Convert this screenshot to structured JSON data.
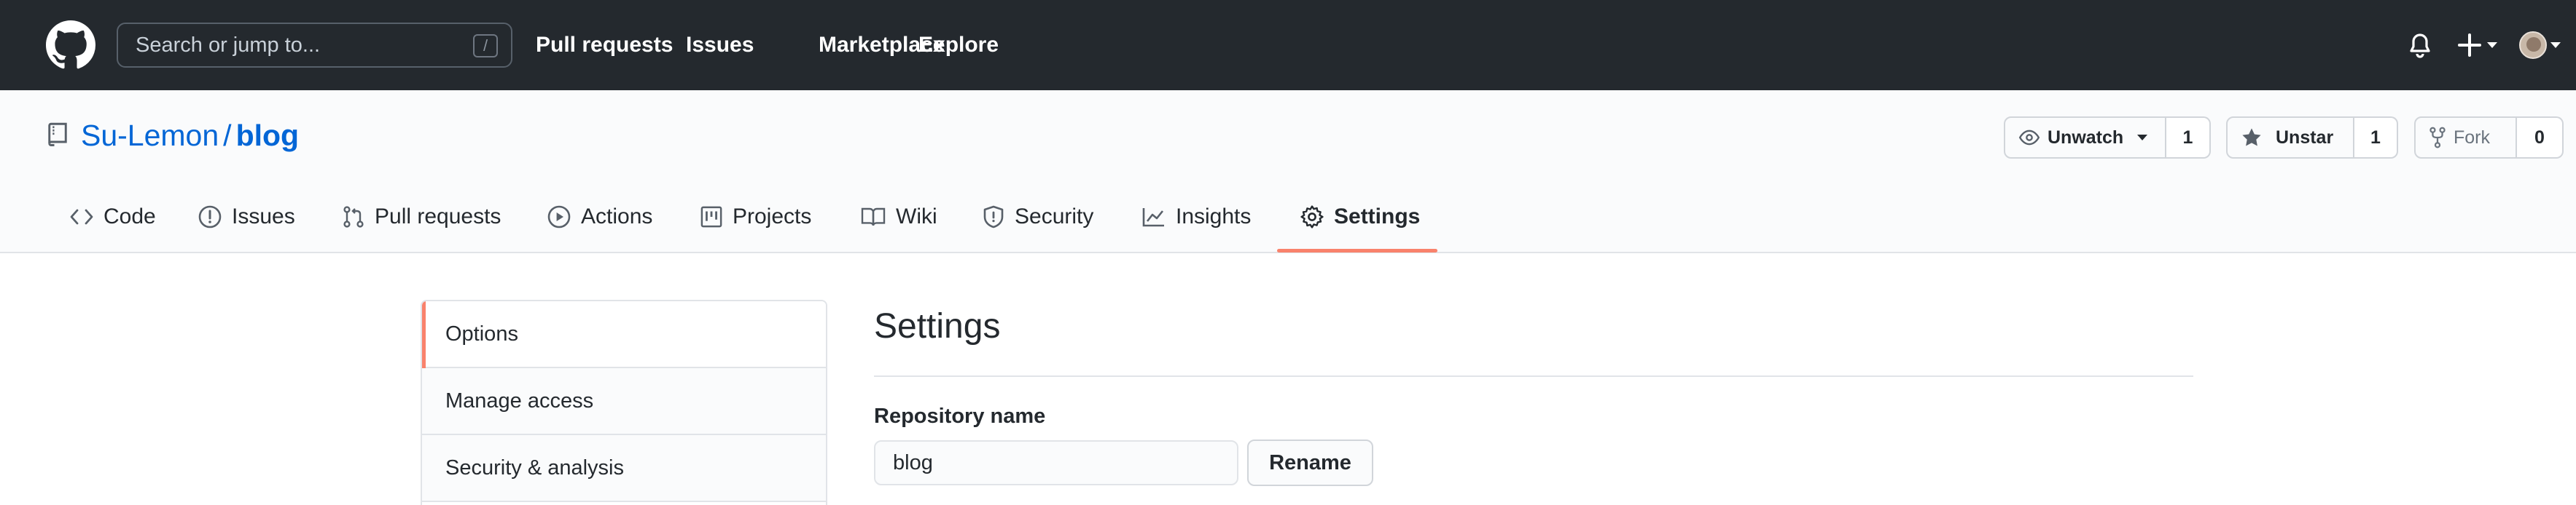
{
  "header": {
    "search_placeholder": "Search or jump to...",
    "search_shortcut": "/",
    "nav": [
      "Pull requests",
      "Issues",
      "Marketplace",
      "Explore"
    ]
  },
  "repo": {
    "owner": "Su-Lemon",
    "separator": "/",
    "name": "blog",
    "watch": {
      "label": "Unwatch",
      "count": "1"
    },
    "star": {
      "label": "Unstar",
      "count": "1"
    },
    "fork": {
      "label": "Fork",
      "count": "0"
    }
  },
  "tabs": [
    "Code",
    "Issues",
    "Pull requests",
    "Actions",
    "Projects",
    "Wiki",
    "Security",
    "Insights",
    "Settings"
  ],
  "selected_tab": "Settings",
  "menu": [
    "Options",
    "Manage access",
    "Security & analysis"
  ],
  "settings": {
    "title": "Settings",
    "repo_name_label": "Repository name",
    "repo_name_value": "blog",
    "rename_label": "Rename"
  },
  "colors": {
    "header_bg": "#24292e",
    "link": "#0366d6",
    "accent": "#f9826c",
    "border": "#e1e4e8"
  }
}
